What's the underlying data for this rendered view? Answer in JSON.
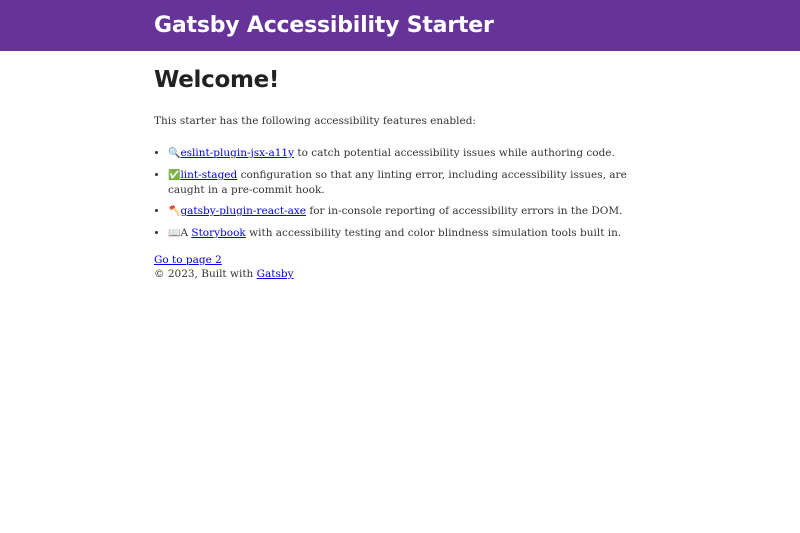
{
  "header": {
    "title": "Gatsby Accessibility Starter",
    "background_color": "#663399"
  },
  "main": {
    "heading": "Welcome!",
    "intro": "This starter has the following accessibility features enabled:",
    "features": [
      {
        "icon": "magnifier-icon",
        "glyph": "🔍",
        "link_text": "eslint-plugin-jsx-a11y",
        "text": " to catch potential accessibility issues while authoring code."
      },
      {
        "icon": "check-mark-icon",
        "glyph": "✅",
        "link_text": "lint-staged",
        "text": " configuration so that any linting error, including accessibility issues, are caught in a pre-commit hook."
      },
      {
        "icon": "axe-icon",
        "glyph": "🪓",
        "link_text": "gatsby-plugin-react-axe",
        "text": " for in-console reporting of accessibility errors in the DOM."
      },
      {
        "icon": "book-icon",
        "glyph": "📖",
        "prefix": "A ",
        "link_text": "Storybook",
        "text": " with accessibility testing and color blindness simulation tools built in."
      }
    ],
    "page2_link": "Go to page 2"
  },
  "footer": {
    "text": "© 2023, Built with ",
    "link_text": "Gatsby"
  },
  "colors": {
    "link": "#0000ee",
    "text": "#333333"
  }
}
